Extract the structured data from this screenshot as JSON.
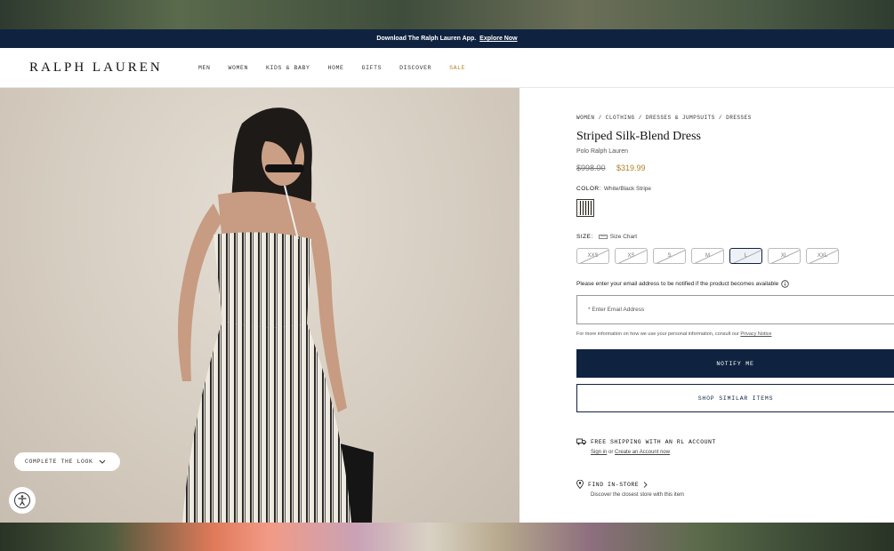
{
  "promo": {
    "text": "Download The Ralph Lauren App.",
    "link": "Explore Now"
  },
  "header": {
    "logo": "RALPH LAUREN",
    "nav": [
      "MEN",
      "WOMEN",
      "KIDS & BABY",
      "HOME",
      "GIFTS",
      "DISCOVER",
      "SALE"
    ]
  },
  "photo": {
    "complete_look_label": "COMPLETE THE LOOK"
  },
  "product": {
    "breadcrumb": "WOMEN / CLOTHING / DRESSES & JUMPSUITS / DRESSES",
    "title": "Striped Silk-Blend Dress",
    "brand": "Polo Ralph Lauren",
    "price_original": "$998.00",
    "price_sale": "$319.99",
    "color_label": "COLOR:",
    "color_value": "White/Black Stripe",
    "size_label": "SIZE:",
    "size_chart_label": "Size Chart",
    "sizes": [
      "XXS",
      "XS",
      "S",
      "M",
      "L",
      "XL",
      "XXL"
    ],
    "selected_size": "L",
    "notify_message": "Please enter your email address to be notified if the product becomes available",
    "email_placeholder": "* Enter Email Address",
    "info_text": "For more information on how we use your personal information, consult our",
    "info_link": "Privacy Notice",
    "notify_button": "NOTIFY ME",
    "similar_button": "SHOP SIMILAR ITEMS"
  },
  "shipping": {
    "title": "FREE SHIPPING WITH AN RL ACCOUNT",
    "sign_in": "Sign in",
    "or": "or",
    "create": "Create an Account now"
  },
  "store": {
    "title": "FIND IN-STORE",
    "subtitle": "Discover the closest store with this item"
  }
}
